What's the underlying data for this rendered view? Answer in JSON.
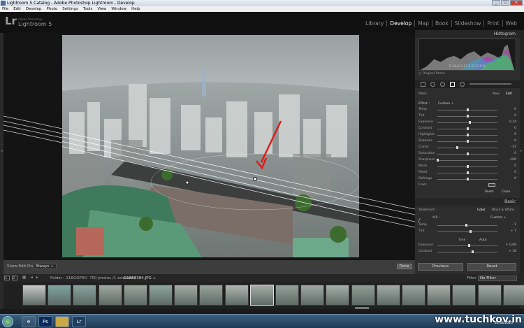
{
  "window": {
    "title": "Lightroom 5 Catalog - Adobe Photoshop Lightroom - Develop"
  },
  "menu": [
    "File",
    "Edit",
    "Develop",
    "Photo",
    "Settings",
    "Tools",
    "View",
    "Window",
    "Help"
  ],
  "identity": {
    "logo": "Lr",
    "subtitle": "Adobe Photoshop",
    "title": "Lightroom 5"
  },
  "modules": [
    "Library",
    "Develop",
    "Map",
    "Book",
    "Slideshow",
    "Print",
    "Web"
  ],
  "active_module": "Develop",
  "histogram": {
    "title": "Histogram",
    "readout": "R 19,0  G 17,3  B 17,5 %",
    "original_photo": "Original Photo"
  },
  "mask": {
    "label": "Mask :",
    "new": "New",
    "edit": "Edit"
  },
  "effect": {
    "label": "Effect :",
    "preset": "Custom ÷"
  },
  "effect_sliders": [
    {
      "name": "Temp",
      "value": "0",
      "pos": 0.5
    },
    {
      "name": "Tint",
      "value": "0",
      "pos": 0.5
    },
    {
      "name": "Exposure",
      "value": "0,14",
      "pos": 0.54
    },
    {
      "name": "Contrast",
      "value": "0",
      "pos": 0.5
    },
    {
      "name": "Highlights",
      "value": "0",
      "pos": 0.5
    },
    {
      "name": "Shadows",
      "value": "0",
      "pos": 0.5
    },
    {
      "name": "Clarity",
      "value": "-37",
      "pos": 0.32
    },
    {
      "name": "Saturation",
      "value": "0",
      "pos": 0.5
    },
    {
      "name": "Sharpness",
      "value": "-100",
      "pos": 0.0
    },
    {
      "name": "Noise",
      "value": "0",
      "pos": 0.5
    },
    {
      "name": "Moiré",
      "value": "0",
      "pos": 0.5
    },
    {
      "name": "Defringe",
      "value": "0",
      "pos": 0.5
    }
  ],
  "color_label": "Color",
  "mask_buttons": {
    "reset": "Reset",
    "close": "Close"
  },
  "basic": {
    "title": "Basic",
    "treatment_label": "Treatment :",
    "color": "Color",
    "bw": "Black & White",
    "wb_label": "WB :",
    "wb_value": "Custom ÷",
    "tone_label": "Tone",
    "auto": "Auto"
  },
  "basic_sliders": [
    {
      "name": "Temp",
      "value": "- 1",
      "pos": 0.48
    },
    {
      "name": "Tint",
      "value": "+ 7",
      "pos": 0.55
    },
    {
      "name": "Exposure",
      "value": "+ 0,08",
      "pos": 0.52
    },
    {
      "name": "Contrast",
      "value": "+ 18",
      "pos": 0.58
    }
  ],
  "bottom_buttons": {
    "previous": "Previous",
    "reset": "Reset"
  },
  "toolbar": {
    "show_pins_label": "Show Edit Pins :",
    "show_pins_value": "Always ÷",
    "done": "Done"
  },
  "filmbar": {
    "pages": [
      "1",
      "2"
    ],
    "folder": "Folder : 116GOPRO",
    "count": "750 photos /1 selected /",
    "file": "G1868384.JPG ÷",
    "filter_label": "Filter :",
    "filter_value": "No Filter"
  },
  "taskbar": {
    "watermark": "www.tuchkov.in",
    "date": "21.06.2015",
    "apps": [
      "e",
      "Ps",
      "Lr"
    ]
  }
}
